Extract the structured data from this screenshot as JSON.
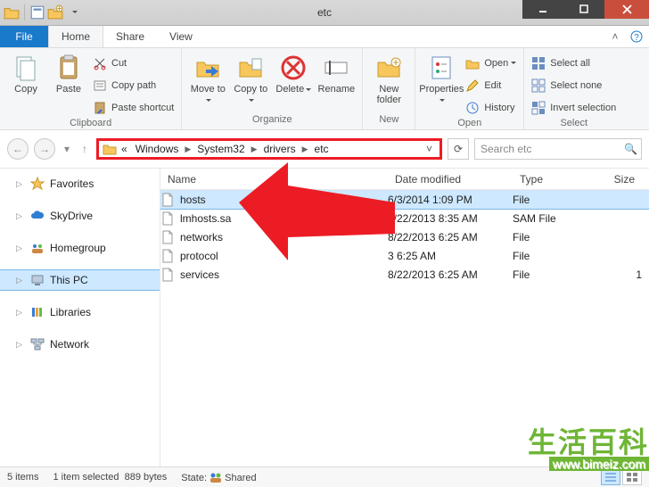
{
  "window": {
    "title": "etc"
  },
  "tabs": {
    "file": "File",
    "home": "Home",
    "share": "Share",
    "view": "View"
  },
  "ribbon": {
    "clipboard": {
      "label": "Clipboard",
      "copy": "Copy",
      "paste": "Paste",
      "cut": "Cut",
      "copy_path": "Copy path",
      "paste_shortcut": "Paste shortcut"
    },
    "organize": {
      "label": "Organize",
      "move_to": "Move\nto",
      "copy_to": "Copy\nto",
      "delete": "Delete",
      "rename": "Rename"
    },
    "new": {
      "label": "New",
      "new_folder": "New\nfolder"
    },
    "open": {
      "label": "Open",
      "properties": "Properties",
      "open": "Open",
      "edit": "Edit",
      "history": "History"
    },
    "select": {
      "label": "Select",
      "select_all": "Select all",
      "select_none": "Select none",
      "invert": "Invert selection"
    }
  },
  "address": {
    "crumbs": [
      "Windows",
      "System32",
      "drivers",
      "etc"
    ],
    "prefix": "«"
  },
  "search": {
    "placeholder": "Search etc"
  },
  "nav": {
    "favorites": "Favorites",
    "skydrive": "SkyDrive",
    "homegroup": "Homegroup",
    "this_pc": "This PC",
    "libraries": "Libraries",
    "network": "Network"
  },
  "columns": {
    "name": "Name",
    "date": "Date modified",
    "type": "Type",
    "size": "Size"
  },
  "files": [
    {
      "name": "hosts",
      "date": "6/3/2014 1:09 PM",
      "type": "File",
      "size": "",
      "selected": true
    },
    {
      "name": "lmhosts.sa",
      "date": "8/22/2013 8:35 AM",
      "type": "SAM File",
      "size": ""
    },
    {
      "name": "networks",
      "date": "8/22/2013 6:25 AM",
      "type": "File",
      "size": ""
    },
    {
      "name": "protocol",
      "date": "",
      "type": "File",
      "size": "",
      "partial_date": "3 6:25 AM"
    },
    {
      "name": "services",
      "date": "8/22/2013 6:25 AM",
      "type": "File",
      "size": "1"
    }
  ],
  "status": {
    "items": "5 items",
    "selected": "1 item selected",
    "bytes": "889 bytes",
    "state_label": "State:",
    "state": "Shared"
  },
  "watermark": {
    "text": "生活百科",
    "url": "www.bimeiz.com"
  }
}
